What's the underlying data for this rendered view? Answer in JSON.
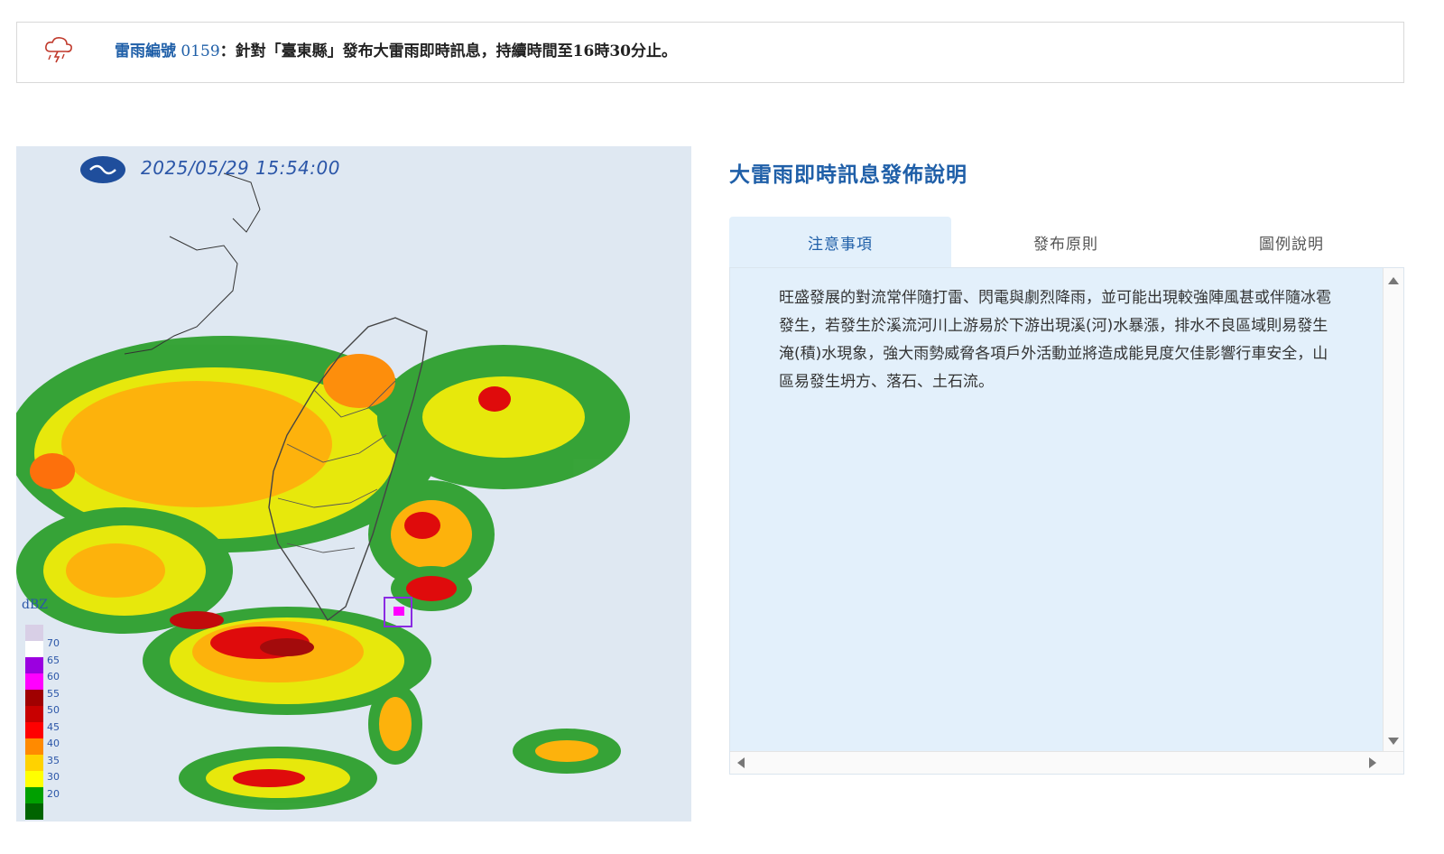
{
  "alert": {
    "icon": "thunderstorm-icon",
    "code_label": "雷雨編號",
    "code_number": "0159",
    "message": "：針對「臺東縣」發布大雷雨即時訊息，持續時間至16時30分止。"
  },
  "radar": {
    "timestamp": "2025/05/29 15:54:00",
    "logo_icon": "cwa-logo-icon",
    "legend_title": "dBZ",
    "legend_ticks": [
      "70",
      "65",
      "60",
      "55",
      "50",
      "45",
      "40",
      "35",
      "30",
      "20"
    ],
    "legend_colors": [
      "#d8cfe6",
      "#ffffff",
      "#9b00e0",
      "#ff00ff",
      "#a00000",
      "#c80000",
      "#ff0000",
      "#ff8a00",
      "#ffd200",
      "#ffff00",
      "#00a000",
      "#006400"
    ]
  },
  "panel": {
    "title": "大雷雨即時訊息發佈說明",
    "tabs": [
      {
        "label": "注意事項"
      },
      {
        "label": "發布原則"
      },
      {
        "label": "圖例說明"
      }
    ],
    "content": "旺盛發展的對流常伴隨打雷、閃電與劇烈降雨，並可能出現較強陣風甚或伴隨冰雹發生，若發生於溪流河川上游易於下游出現溪(河)水暴漲，排水不良區域則易發生淹(積)水現象，強大雨勢威脅各項戶外活動並將造成能見度欠佳影響行車安全，山區易發生坍方、落石、土石流。"
  }
}
